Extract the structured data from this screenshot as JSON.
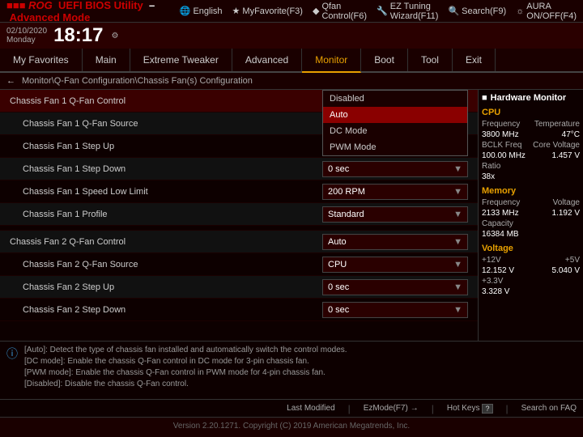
{
  "window": {
    "title_prefix": "UEFI BIOS Utility",
    "title_mode": "Advanced Mode",
    "brand": "ROG"
  },
  "datetime": {
    "date": "02/10/2020",
    "day": "Monday",
    "time": "18:17"
  },
  "topbar": {
    "language": "English",
    "myfavorites": "MyFavorite(F3)",
    "qfan": "Qfan Control(F6)",
    "eztuning": "EZ Tuning Wizard(F11)",
    "search": "Search(F9)",
    "aura": "AURA ON/OFF(F4)"
  },
  "nav": {
    "tabs": [
      {
        "label": "My Favorites",
        "active": false
      },
      {
        "label": "Main",
        "active": false
      },
      {
        "label": "Extreme Tweaker",
        "active": false
      },
      {
        "label": "Advanced",
        "active": false
      },
      {
        "label": "Monitor",
        "active": true
      },
      {
        "label": "Boot",
        "active": false
      },
      {
        "label": "Tool",
        "active": false
      },
      {
        "label": "Exit",
        "active": false
      }
    ]
  },
  "breadcrumb": {
    "path": "Monitor\\Q-Fan Configuration\\Chassis Fan(s) Configuration"
  },
  "settings": [
    {
      "label": "Chassis Fan 1 Q-Fan Control",
      "value": "Auto",
      "highlighted": true,
      "dropdown": true
    },
    {
      "label": "Chassis Fan 1 Q-Fan Source",
      "value": "",
      "indent": true
    },
    {
      "label": "Chassis Fan 1 Step Up",
      "value": "",
      "indent": true
    },
    {
      "label": "Chassis Fan 1 Step Down",
      "value": "0 sec",
      "indent": true,
      "has_value": true
    },
    {
      "label": "Chassis Fan 1 Speed Low Limit",
      "value": "200 RPM",
      "indent": true,
      "has_value": true
    },
    {
      "label": "Chassis Fan 1 Profile",
      "value": "Standard",
      "indent": true,
      "has_value": true
    },
    {
      "label": "Chassis Fan 2 Q-Fan Control",
      "value": "Auto",
      "indent": false,
      "has_value": true
    },
    {
      "label": "Chassis Fan 2 Q-Fan Source",
      "value": "CPU",
      "indent": true,
      "has_value": true
    },
    {
      "label": "Chassis Fan 2 Step Up",
      "value": "0 sec",
      "indent": true,
      "has_value": true
    },
    {
      "label": "Chassis Fan 2 Step Down",
      "value": "0 sec",
      "indent": true,
      "has_value": true
    }
  ],
  "dropdown_options": [
    {
      "label": "Disabled",
      "selected": false
    },
    {
      "label": "Auto",
      "selected": true
    },
    {
      "label": "DC Mode",
      "selected": false
    },
    {
      "label": "PWM Mode",
      "selected": false
    }
  ],
  "info_text": "[Auto]: Detect the type of chassis fan installed and automatically switch the control modes.\n[DC mode]: Enable the chassis Q-Fan control in DC mode for 3-pin chassis fan.\n[PWM mode]: Enable the chassis Q-Fan control in PWM mode for 4-pin chassis fan.\n[Disabled]: Disable the chassis Q-Fan control.",
  "hw_monitor": {
    "title": "Hardware Monitor",
    "cpu": {
      "section": "CPU",
      "freq_label": "Frequency",
      "freq_value": "3800 MHz",
      "temp_label": "Temperature",
      "temp_value": "47°C",
      "bclk_label": "BCLK Freq",
      "bclk_value": "100.00 MHz",
      "core_label": "Core Voltage",
      "core_value": "1.457 V",
      "ratio_label": "Ratio",
      "ratio_value": "38x"
    },
    "memory": {
      "section": "Memory",
      "freq_label": "Frequency",
      "freq_value": "2133 MHz",
      "volt_label": "Voltage",
      "volt_value": "1.192 V",
      "cap_label": "Capacity",
      "cap_value": "16384 MB"
    },
    "voltage": {
      "section": "Voltage",
      "v12_label": "+12V",
      "v12_value": "12.152 V",
      "v5_label": "+5V",
      "v5_value": "5.040 V",
      "v33_label": "+3.3V",
      "v33_value": "3.328 V"
    }
  },
  "action_bar": {
    "last_modified": "Last Modified",
    "ez_mode": "EzMode(F7)",
    "hot_keys": "Hot Keys",
    "hot_keys_key": "?",
    "search_faq": "Search on FAQ"
  },
  "footer": {
    "text": "Version 2.20.1271. Copyright (C) 2019 American Megatrends, Inc."
  }
}
